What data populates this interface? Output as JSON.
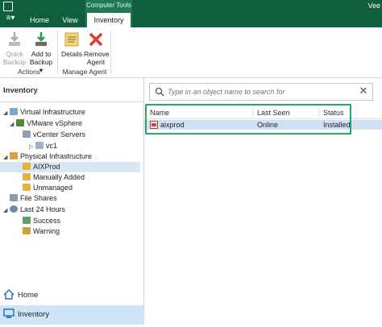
{
  "title_bar": {
    "context_group_label": "Computer Tools",
    "brand_fragment": "Vee"
  },
  "tabs": [
    {
      "label": "Home"
    },
    {
      "label": "View"
    },
    {
      "label": "Inventory"
    }
  ],
  "app_menu_label": "≡▾",
  "ribbon": {
    "quick_backup": {
      "line1": "Quick",
      "line2": "Backup"
    },
    "add_to_backup": {
      "line1": "Add to",
      "line2": "Backup ▾"
    },
    "actions_label": "Actions",
    "details": "Details",
    "remove_agent": {
      "line1": "Remove",
      "line2": "Agent"
    },
    "manage_agent_label": "Manage Agent"
  },
  "left_pane": {
    "title": "Inventory",
    "tree": [
      {
        "label": "Virtual Infrastructure",
        "icon": "virtual-infrastructure-icon"
      },
      {
        "label": "VMware vSphere",
        "icon": "vmware-icon"
      },
      {
        "label": "vCenter Servers",
        "icon": "vcenter-icon"
      },
      {
        "label": "vc1",
        "icon": "vc-icon"
      },
      {
        "label": "Physical Infrastructure",
        "icon": "physical-infrastructure-icon"
      },
      {
        "label": "AIXProd",
        "icon": "folder-icon",
        "selected": true
      },
      {
        "label": "Manually Added",
        "icon": "folder-icon"
      },
      {
        "label": "Unmanaged",
        "icon": "folder-icon"
      },
      {
        "label": "File Shares",
        "icon": "file-shares-icon"
      },
      {
        "label": "Last 24 Hours",
        "icon": "history-icon"
      },
      {
        "label": "Success",
        "icon": "success-icon"
      },
      {
        "label": "Warning",
        "icon": "warning-icon"
      }
    ],
    "nav": {
      "home": "Home",
      "inventory": "Inventory"
    }
  },
  "search": {
    "placeholder": "Type in an object name to search for",
    "value": ""
  },
  "grid": {
    "columns": [
      "Name",
      "Last Seen",
      "Status"
    ],
    "rows": [
      {
        "name": "aixprod",
        "last_seen": "Online",
        "status": "Installed"
      }
    ]
  },
  "colors": {
    "brand_green": "#0f5e3e",
    "selection_blue": "#cfe2f5",
    "highlight_green": "#2ea46b"
  }
}
